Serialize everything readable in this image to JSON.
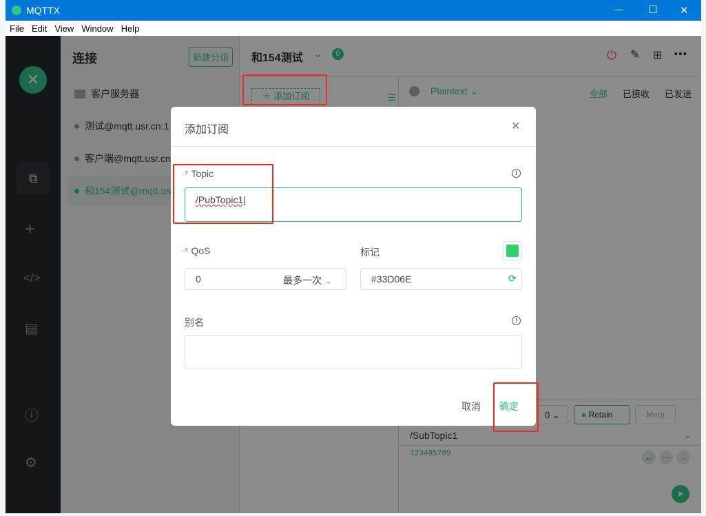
{
  "window": {
    "title": "MQTTX",
    "minimize": "—",
    "maximize": "☐",
    "close": "✕"
  },
  "menu": [
    "File",
    "Edit",
    "View",
    "Window",
    "Help"
  ],
  "connections": {
    "title": "连接",
    "new_group": "新建分组",
    "group": "客户服务器",
    "items": [
      {
        "name": "测试@mqtt.usr.cn:1",
        "status": "offline"
      },
      {
        "name": "客户端@mqtt.usr.cn",
        "status": "offline"
      },
      {
        "name": "和154测试@mqtt.usr.cn",
        "status": "online"
      }
    ]
  },
  "main": {
    "conn_name": "和154测试",
    "sub_count": "0",
    "add_sub": "添加订阅",
    "payload_format": "Plaintext",
    "filters": [
      "全部",
      "已接收",
      "已发送"
    ],
    "qos": "0",
    "retain": "Retain",
    "meta": "Meta",
    "publish_topic": "/SubTopic1",
    "publish_payload": "123485789"
  },
  "dialog": {
    "title": "添加订阅",
    "topic_label": "Topic",
    "topic_value": "/PubTopic1",
    "qos_label": "QoS",
    "qos_value": "0",
    "qos_desc": "最多一次",
    "color_label": "标记",
    "color_value": "#33D06E",
    "alias_label": "别名",
    "alias_value": "",
    "cancel": "取消",
    "confirm": "确定"
  },
  "colors": {
    "accent": "#34c388",
    "titlebar": "#0078d7",
    "mark": "#33D06E",
    "highlight": "#f02a1e"
  }
}
